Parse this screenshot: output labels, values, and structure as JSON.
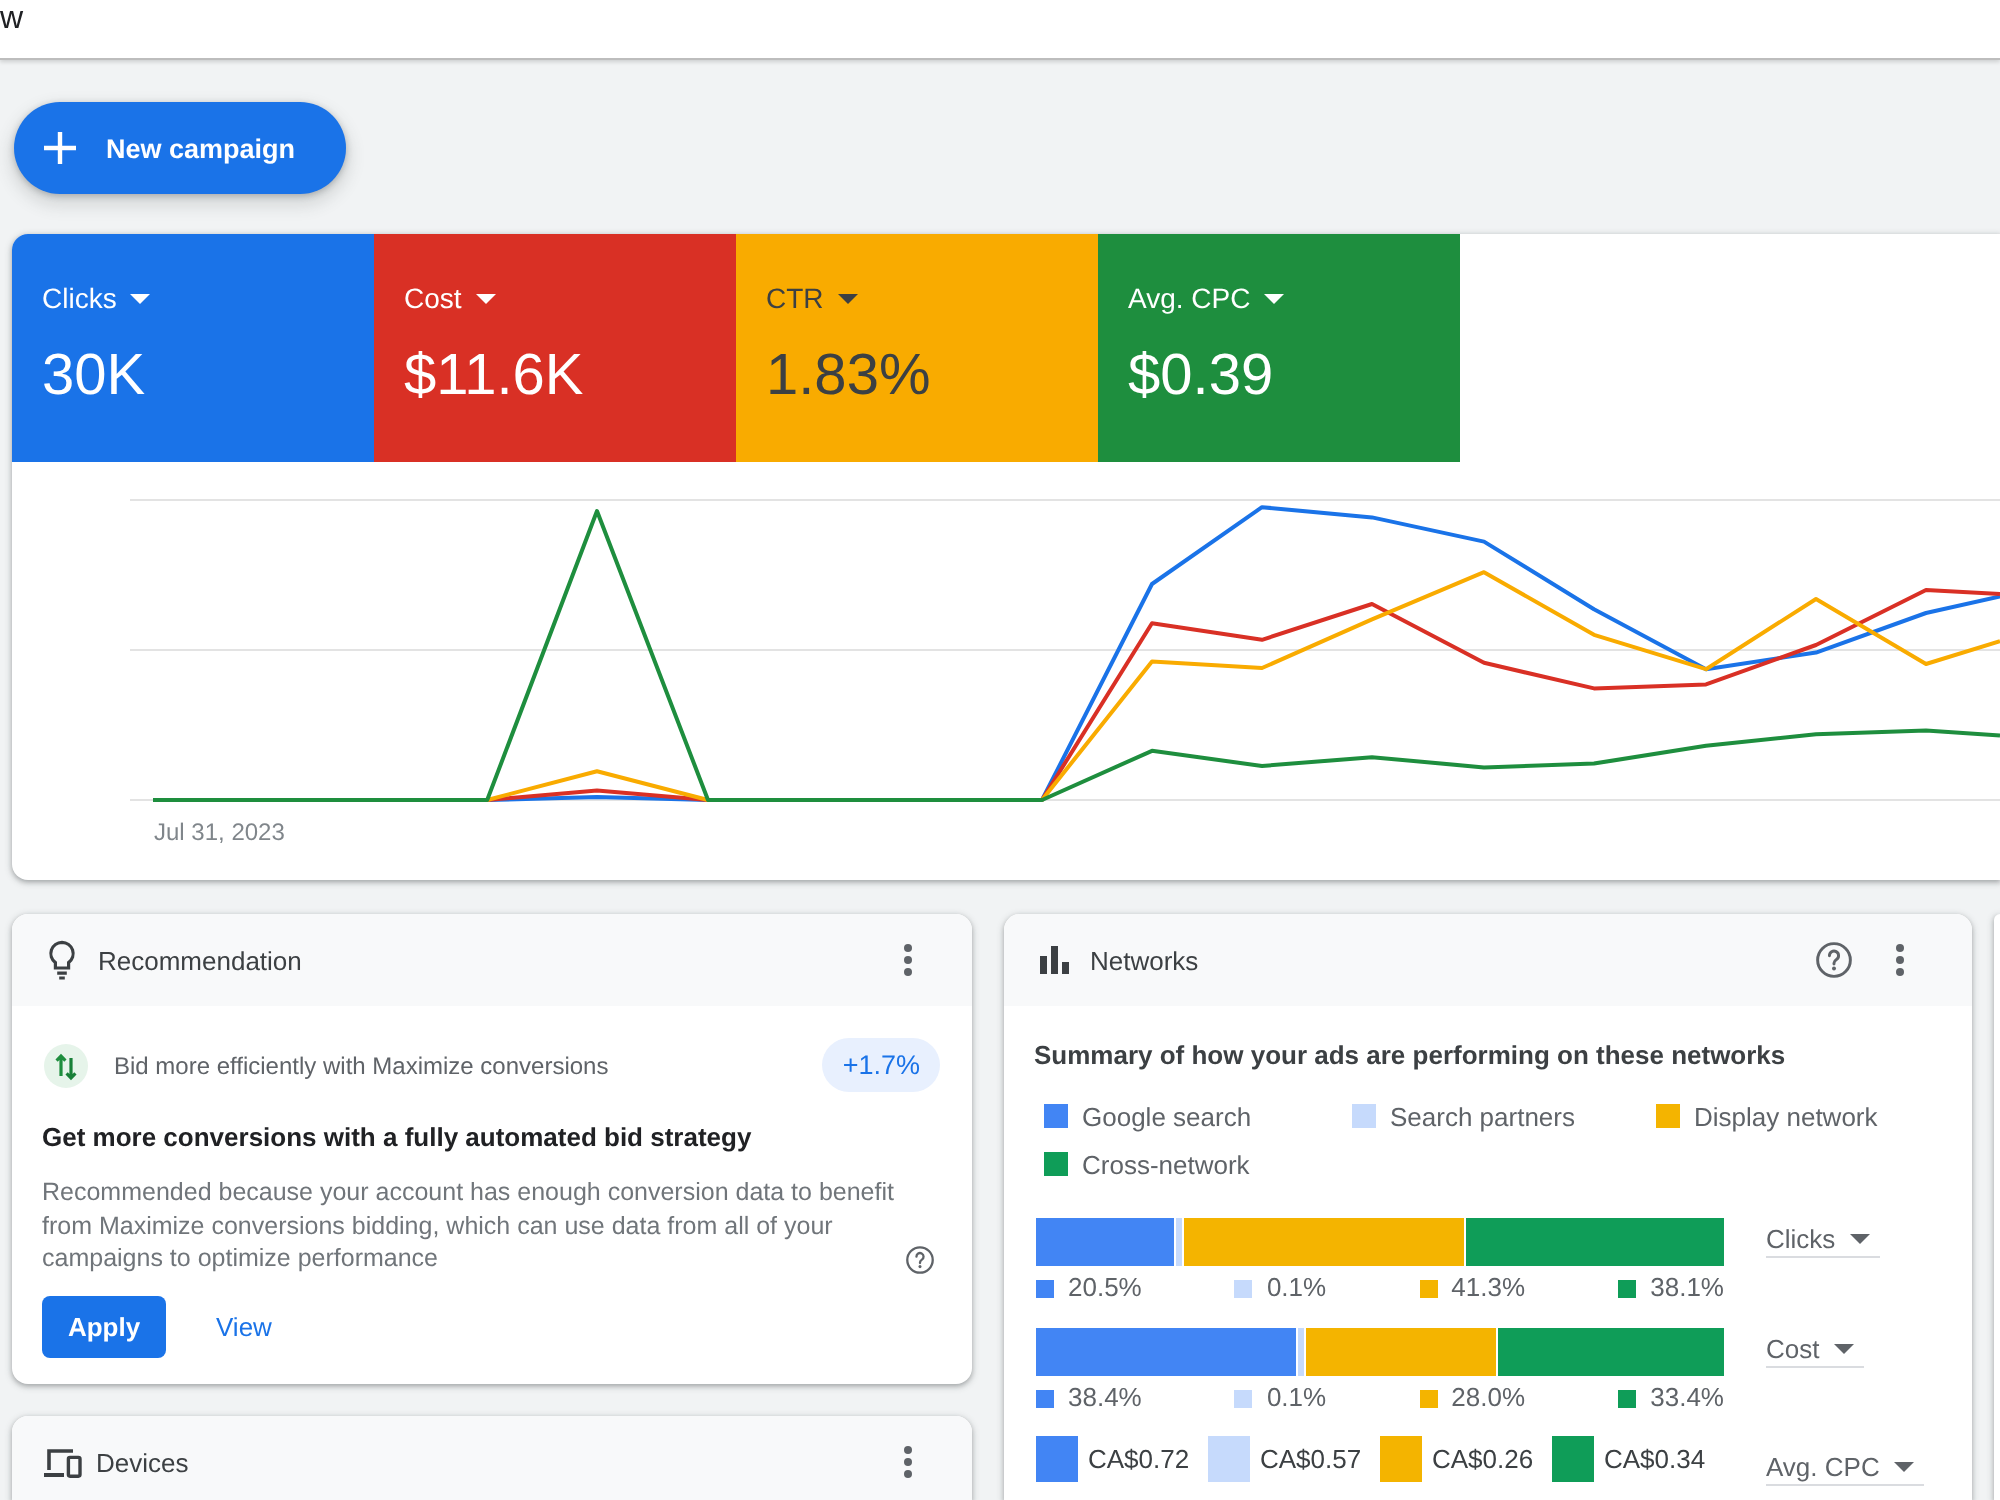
{
  "page_title": "w",
  "new_campaign_button": {
    "label": "New campaign"
  },
  "metrics": [
    {
      "label": "Clicks",
      "value": "30K",
      "color": "#1a73e8",
      "selected": true
    },
    {
      "label": "Cost",
      "value": "$11.6K",
      "color": "#d93025",
      "selected": true
    },
    {
      "label": "CTR",
      "value": "1.83%",
      "color": "#f9ab00",
      "selected": true
    },
    {
      "label": "Avg. CPC",
      "value": "$0.39",
      "color": "#1e8e3e",
      "selected": true
    }
  ],
  "performance_chart": {
    "date_label": "Jul 31, 2023"
  },
  "recommendation": {
    "title": "Recommendation",
    "item": {
      "text": "Bid more efficiently with Maximize conversions",
      "uplift": "+1.7%"
    },
    "heading": "Get more conversions with a fully automated bid strategy",
    "description": "Recommended because your account has enough conversion data to benefit from Maximize conversions bidding, which can use data from all of your campaigns to optimize performance",
    "buttons": [
      {
        "label": "Apply",
        "kind": "primary"
      },
      {
        "label": "View",
        "kind": "text"
      }
    ]
  },
  "networks": {
    "title": "Networks",
    "summary": "Summary of how your ads are performing on these networks",
    "legend": [
      {
        "label": "Google search",
        "color": "#4285f4"
      },
      {
        "label": "Search partners",
        "color": "#c6dafc"
      },
      {
        "label": "Display network",
        "color": "#f4b400"
      },
      {
        "label": "Cross-network",
        "color": "#0f9d58"
      }
    ],
    "bars": [
      {
        "metric": "Clicks",
        "segments": [
          {
            "label": "20.5%",
            "color": "#4285f4"
          },
          {
            "label": "0.1%",
            "color": "#c6dafc"
          },
          {
            "label": "41.3%",
            "color": "#f4b400"
          },
          {
            "label": "38.1%",
            "color": "#0f9d58"
          }
        ]
      },
      {
        "metric": "Cost",
        "segments": [
          {
            "label": "38.4%",
            "color": "#4285f4"
          },
          {
            "label": "0.1%",
            "color": "#c6dafc"
          },
          {
            "label": "28.0%",
            "color": "#f4b400"
          },
          {
            "label": "33.4%",
            "color": "#0f9d58"
          }
        ]
      }
    ],
    "cpc": {
      "metric": "Avg. CPC",
      "values": [
        {
          "value": "CA$0.72",
          "color": "#4285f4"
        },
        {
          "value": "CA$0.57",
          "color": "#c6dafc"
        },
        {
          "value": "CA$0.26",
          "color": "#f4b400"
        },
        {
          "value": "CA$0.34",
          "color": "#0f9d58"
        }
      ]
    }
  },
  "devices": {
    "title": "Devices"
  }
}
